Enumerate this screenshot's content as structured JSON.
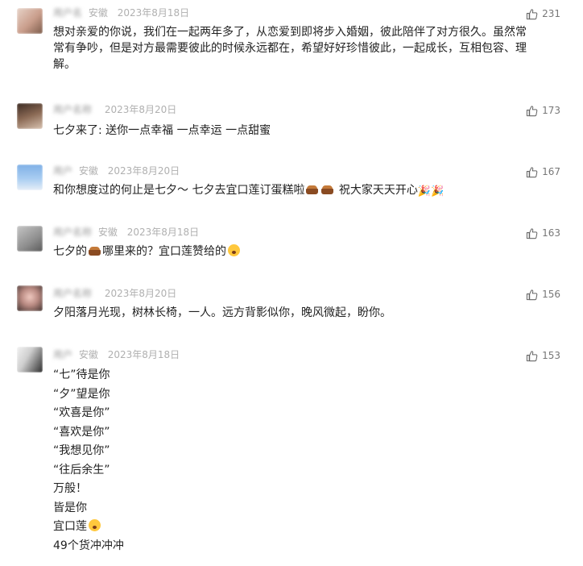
{
  "comments": [
    {
      "user": "用户名",
      "location": "安徽",
      "date": "2023年8月18日",
      "likes": "231",
      "lines": [
        "想对亲爱的你说，我们在一起两年多了，从恋爱到即将步入婚姻，彼此陪伴了对方很久。虽然常",
        "常有争吵，但是对方最需要彼此的时候永远都在，希望好好珍惜彼此，一起成长，互相包容、理",
        "解。"
      ]
    },
    {
      "user": "用户名称",
      "location": "",
      "date": "2023年8月20日",
      "likes": "173",
      "lines": [
        "七夕来了: 送你一点幸福  一点幸运 一点甜蜜"
      ]
    },
    {
      "user": "用户",
      "location": "安徽",
      "date": "2023年8月20日",
      "likes": "167",
      "text_a": "和你想度过的何止是七夕～    七夕去宜口莲订蛋糕啦",
      "text_b": "  祝大家天天开心"
    },
    {
      "user": "用户名称",
      "location": "安徽",
      "date": "2023年8月18日",
      "likes": "163",
      "text_a": "七夕的",
      "text_b": "哪里来的？宜口莲赞给的"
    },
    {
      "user": "用户名称",
      "location": "",
      "date": "2023年8月20日",
      "likes": "156",
      "lines": [
        "夕阳落月光现，树林长椅，一人。远方背影似你，晚风微起，盼你。"
      ]
    },
    {
      "user": "用户",
      "location": "安徽",
      "date": "2023年8月18日",
      "likes": "153",
      "lines": [
        "“七”待是你",
        "“夕”望是你",
        "“欢喜是你”",
        "“喜欢是你”",
        "“我想见你”",
        "“往后余生”",
        "万般！",
        "皆是你",
        "宜口莲",
        "49个货冲冲冲"
      ]
    }
  ],
  "icons": {
    "like": "thumbs-up-icon"
  },
  "colors": {
    "meta": "#aaaaaa",
    "text": "#222222",
    "divider": "#ececec"
  }
}
